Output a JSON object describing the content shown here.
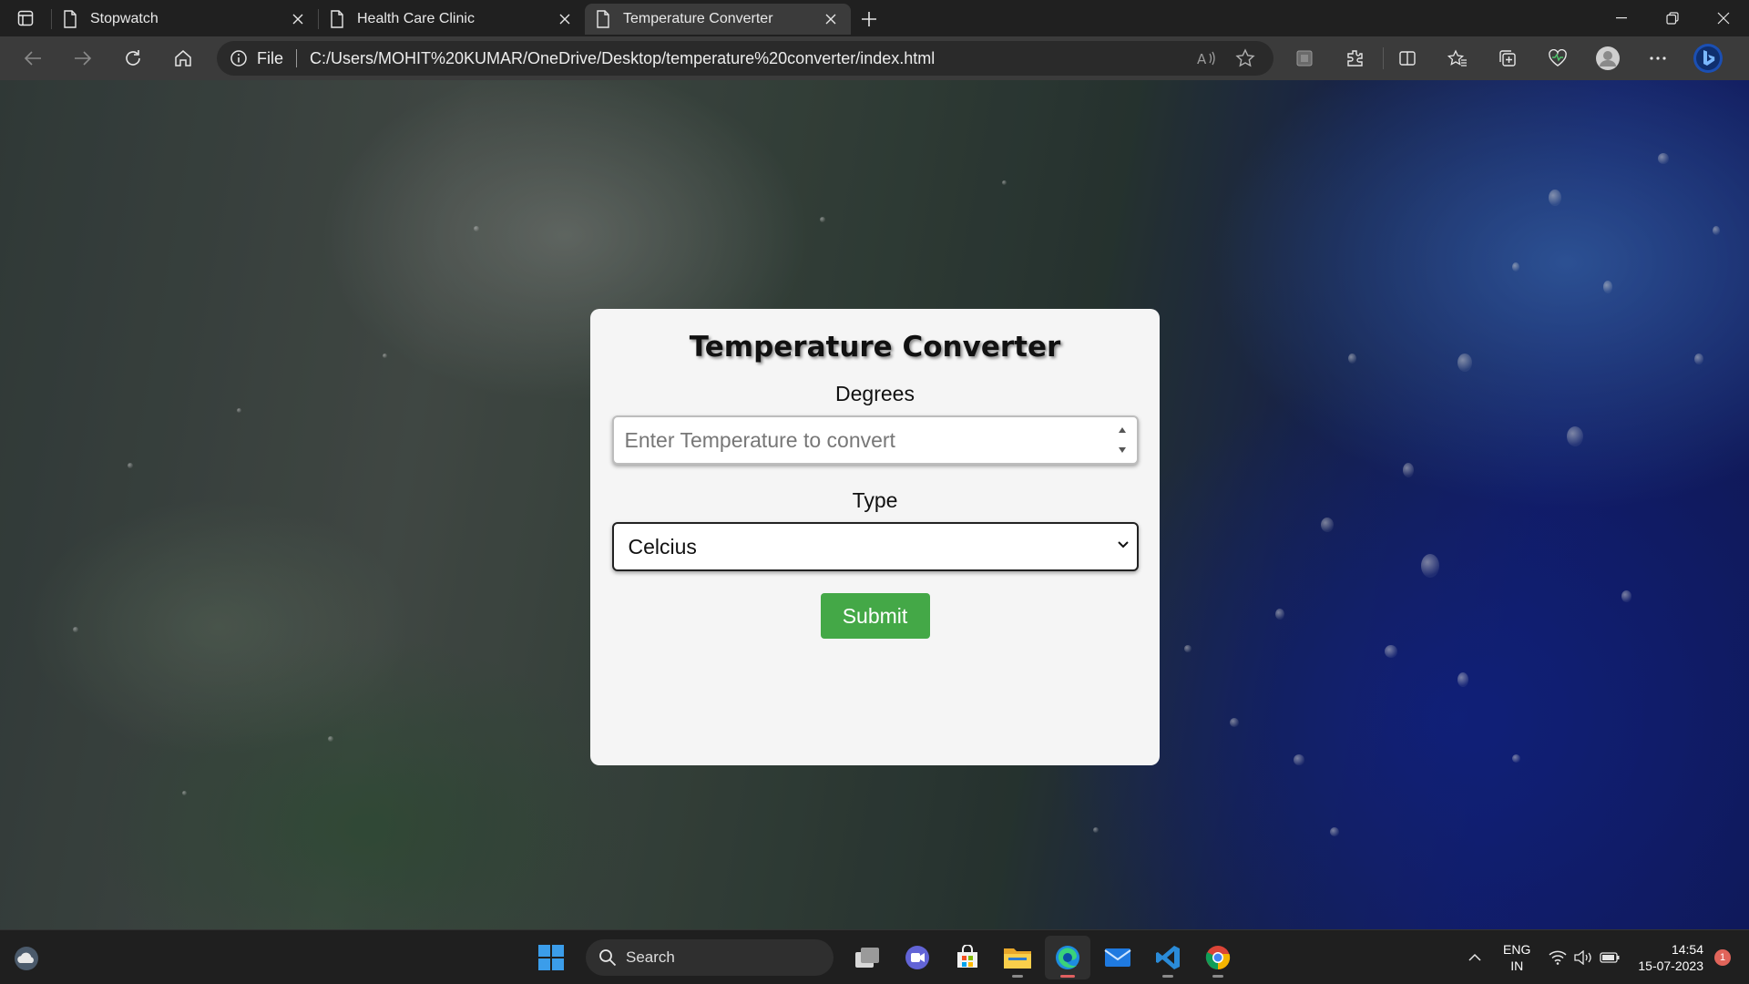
{
  "browser": {
    "tabs": [
      {
        "title": "Stopwatch",
        "active": false
      },
      {
        "title": "Health Care Clinic",
        "active": false
      },
      {
        "title": "Temperature Converter",
        "active": true
      }
    ],
    "address": {
      "scheme_label": "File",
      "url": "C:/Users/MOHIT%20KUMAR/OneDrive/Desktop/temperature%20converter/index.html"
    },
    "toolbar_icons": [
      "back-icon",
      "forward-icon",
      "refresh-icon",
      "home-icon"
    ],
    "address_icons": [
      "read-aloud-icon",
      "favorite-star-icon"
    ],
    "right_icons": [
      "app-icon",
      "extensions-icon",
      "split-screen-icon",
      "favorites-icon",
      "collections-icon",
      "browser-essentials-icon",
      "profile-icon",
      "more-icon",
      "bing-icon"
    ]
  },
  "app": {
    "title": "Temperature Converter",
    "degrees_label": "Degrees",
    "degrees_placeholder": "Enter Temperature to convert",
    "type_label": "Type",
    "type_selected": "Celcius",
    "submit_label": "Submit",
    "colors": {
      "card_bg": "#f5f5f5",
      "submit_bg": "#44a847"
    }
  },
  "taskbar": {
    "search_label": "Search",
    "apps": [
      "task-view-icon",
      "teams-icon",
      "store-icon",
      "file-explorer-icon",
      "edge-icon",
      "mail-icon",
      "vscode-icon",
      "chrome-icon"
    ],
    "tray": {
      "lang_line1": "ENG",
      "lang_line2": "IN",
      "time": "14:54",
      "date": "15-07-2023",
      "notification_count": "1"
    }
  }
}
